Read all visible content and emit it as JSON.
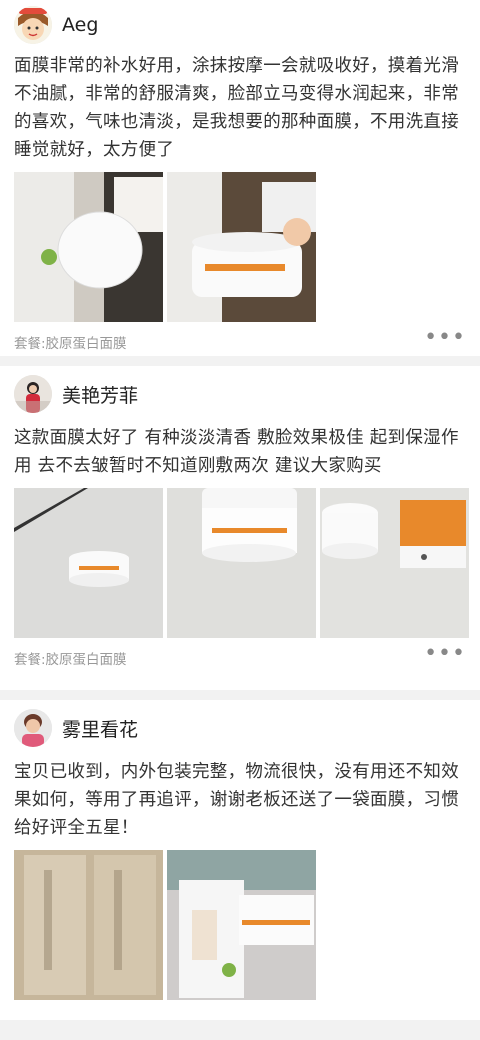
{
  "reviews": [
    {
      "nickname": "Aeg",
      "avatar_icon": "cartoon-face-avatar",
      "content": "面膜非常的补水好用，涂抹按摩一会就吸收好，摸着光滑不油腻，非常的舒服清爽，脸部立马变得水润起来，非常的喜欢，气味也清淡，是我想要的那种面膜，不用洗直接睡觉就好，太方便了",
      "package_label": "套餐:胶原蛋白面膜",
      "more_icon": "more-dots-icon",
      "more_label": "•••"
    },
    {
      "nickname": "美艳芳菲",
      "avatar_icon": "person-photo-avatar",
      "content": "这款面膜太好了 有种淡淡清香 敷脸效果极佳 起到保湿作用 去不去皱暂时不知道刚敷两次 建议大家购买",
      "package_label": "套餐:胶原蛋白面膜",
      "more_icon": "more-dots-icon",
      "more_label": "•••"
    },
    {
      "nickname": "雾里看花",
      "avatar_icon": "person-photo-avatar",
      "content": "宝贝已收到，内外包装完整，物流很快，没有用还不知效果如何，等用了再追评，谢谢老板还送了一袋面膜，习惯给好评全五星！",
      "package_label": "",
      "more_icon": "more-dots-icon",
      "more_label": ""
    }
  ],
  "colors": {
    "background": "#f2f2f2",
    "card": "#ffffff",
    "text": "#333333",
    "muted": "#999999",
    "accent_orange": "#e8892b"
  }
}
